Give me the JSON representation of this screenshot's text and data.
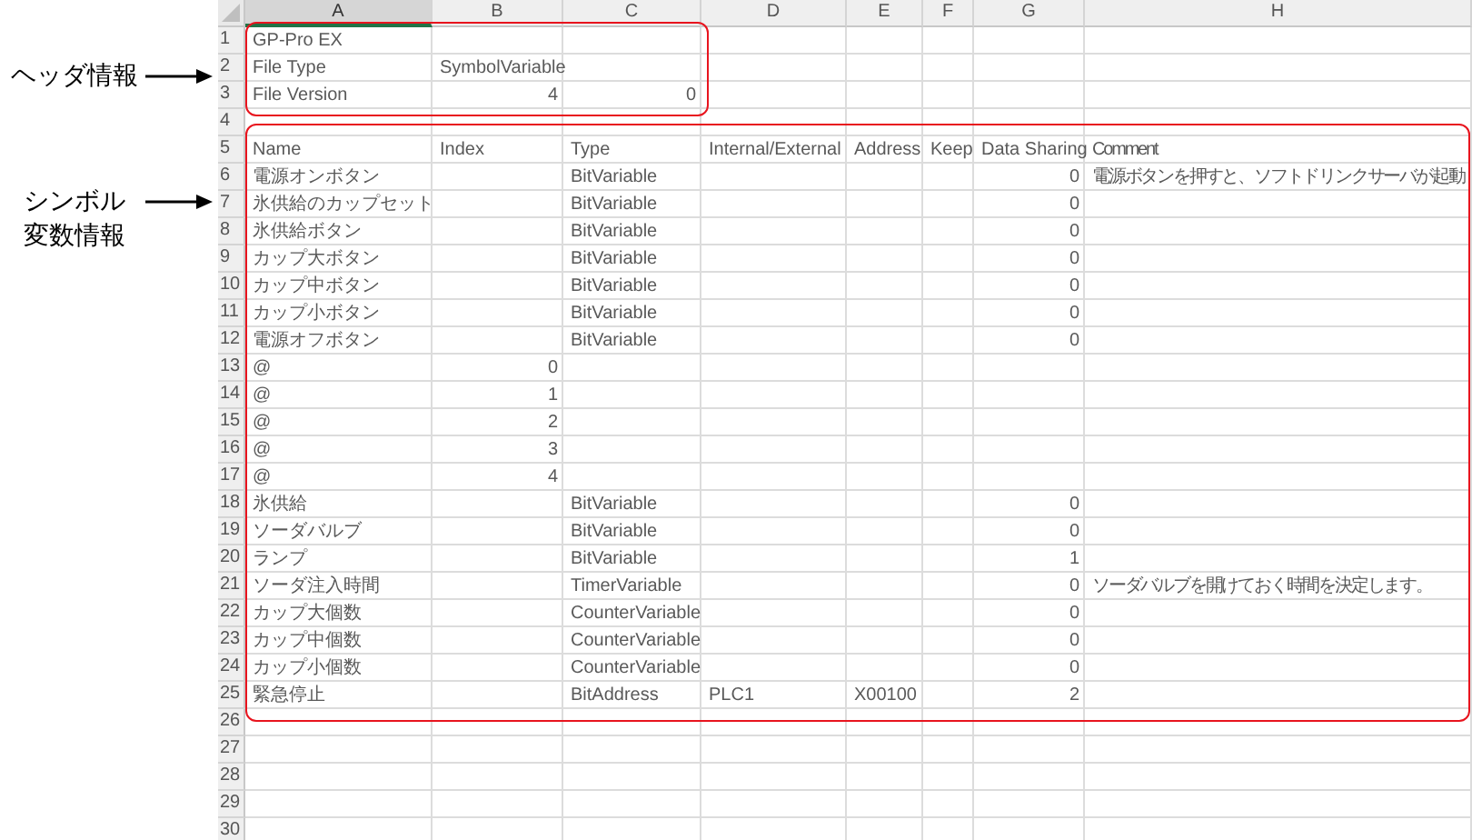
{
  "annotations": [
    {
      "lines": [
        "ヘッダ情報"
      ]
    },
    {
      "lines": [
        "シンボル",
        "変数情報"
      ]
    }
  ],
  "columns": [
    {
      "label": "A",
      "selected": true
    },
    {
      "label": "B",
      "selected": false
    },
    {
      "label": "C",
      "selected": false
    },
    {
      "label": "D",
      "selected": false
    },
    {
      "label": "E",
      "selected": false
    },
    {
      "label": "F",
      "selected": false
    },
    {
      "label": "G",
      "selected": false
    },
    {
      "label": "H",
      "selected": false
    }
  ],
  "rows": [
    {
      "number": "1",
      "cells": [
        {
          "text": "GP-Pro EX"
        }
      ]
    },
    {
      "number": "2",
      "cells": [
        {
          "text": "File Type"
        },
        {
          "text": "SymbolVariable"
        }
      ]
    },
    {
      "number": "3",
      "cells": [
        {
          "text": "File Version"
        },
        {
          "text": "4",
          "kind": "number"
        },
        {
          "text": "0",
          "kind": "number"
        }
      ]
    },
    {
      "number": "4",
      "cells": []
    },
    {
      "number": "5",
      "cells": [
        {
          "text": "Name"
        },
        {
          "text": "Index"
        },
        {
          "text": "Type"
        },
        {
          "text": "Internal/External"
        },
        {
          "text": "Address"
        },
        {
          "text": "Keep"
        },
        {
          "text": "Data Sharing"
        },
        {
          "text": "Comment"
        }
      ]
    },
    {
      "number": "6",
      "cells": [
        {
          "text": "電源オンボタン"
        },
        {},
        {
          "text": "BitVariable"
        },
        {},
        {},
        {},
        {
          "text": "0",
          "kind": "number"
        },
        {
          "text": "電源ボタンを押すと、ソフトドリンクサーバが起動"
        }
      ]
    },
    {
      "number": "7",
      "cells": [
        {
          "text": "氷供給のカップセット"
        },
        {},
        {
          "text": "BitVariable"
        },
        {},
        {},
        {},
        {
          "text": "0",
          "kind": "number"
        }
      ]
    },
    {
      "number": "8",
      "cells": [
        {
          "text": "氷供給ボタン"
        },
        {},
        {
          "text": "BitVariable"
        },
        {},
        {},
        {},
        {
          "text": "0",
          "kind": "number"
        }
      ]
    },
    {
      "number": "9",
      "cells": [
        {
          "text": "カップ大ボタン"
        },
        {},
        {
          "text": "BitVariable"
        },
        {},
        {},
        {},
        {
          "text": "0",
          "kind": "number"
        }
      ]
    },
    {
      "number": "10",
      "cells": [
        {
          "text": "カップ中ボタン"
        },
        {},
        {
          "text": "BitVariable"
        },
        {},
        {},
        {},
        {
          "text": "0",
          "kind": "number"
        }
      ]
    },
    {
      "number": "11",
      "cells": [
        {
          "text": "カップ小ボタン"
        },
        {},
        {
          "text": "BitVariable"
        },
        {},
        {},
        {},
        {
          "text": "0",
          "kind": "number"
        }
      ]
    },
    {
      "number": "12",
      "cells": [
        {
          "text": "電源オフボタン"
        },
        {},
        {
          "text": "BitVariable"
        },
        {},
        {},
        {},
        {
          "text": "0",
          "kind": "number"
        }
      ]
    },
    {
      "number": "13",
      "cells": [
        {
          "text": "@"
        },
        {
          "text": "0",
          "kind": "number"
        }
      ]
    },
    {
      "number": "14",
      "cells": [
        {
          "text": "@"
        },
        {
          "text": "1",
          "kind": "number"
        }
      ]
    },
    {
      "number": "15",
      "cells": [
        {
          "text": "@"
        },
        {
          "text": "2",
          "kind": "number"
        }
      ]
    },
    {
      "number": "16",
      "cells": [
        {
          "text": "@"
        },
        {
          "text": "3",
          "kind": "number"
        }
      ]
    },
    {
      "number": "17",
      "cells": [
        {
          "text": "@"
        },
        {
          "text": "4",
          "kind": "number"
        }
      ]
    },
    {
      "number": "18",
      "cells": [
        {
          "text": "氷供給"
        },
        {},
        {
          "text": "BitVariable"
        },
        {},
        {},
        {},
        {
          "text": "0",
          "kind": "number"
        }
      ]
    },
    {
      "number": "19",
      "cells": [
        {
          "text": "ソーダバルブ"
        },
        {},
        {
          "text": "BitVariable"
        },
        {},
        {},
        {},
        {
          "text": "0",
          "kind": "number"
        }
      ]
    },
    {
      "number": "20",
      "cells": [
        {
          "text": "ランプ"
        },
        {},
        {
          "text": "BitVariable"
        },
        {},
        {},
        {},
        {
          "text": "1",
          "kind": "number"
        }
      ]
    },
    {
      "number": "21",
      "cells": [
        {
          "text": "ソーダ注入時間"
        },
        {},
        {
          "text": "TimerVariable"
        },
        {},
        {},
        {},
        {
          "text": "0",
          "kind": "number"
        },
        {
          "text": "ソーダバルブを開けておく時間を決定します。"
        }
      ]
    },
    {
      "number": "22",
      "cells": [
        {
          "text": "カップ大個数"
        },
        {},
        {
          "text": "CounterVariable"
        },
        {},
        {},
        {},
        {
          "text": "0",
          "kind": "number"
        }
      ]
    },
    {
      "number": "23",
      "cells": [
        {
          "text": "カップ中個数"
        },
        {},
        {
          "text": "CounterVariable"
        },
        {},
        {},
        {},
        {
          "text": "0",
          "kind": "number"
        }
      ]
    },
    {
      "number": "24",
      "cells": [
        {
          "text": "カップ小個数"
        },
        {},
        {
          "text": "CounterVariable"
        },
        {},
        {},
        {},
        {
          "text": "0",
          "kind": "number"
        }
      ]
    },
    {
      "number": "25",
      "cells": [
        {
          "text": "緊急停止"
        },
        {},
        {
          "text": "BitAddress"
        },
        {
          "text": "PLC1"
        },
        {
          "text": "X00100"
        },
        {},
        {
          "text": "2",
          "kind": "number"
        }
      ]
    },
    {
      "number": "26",
      "cells": []
    },
    {
      "number": "27",
      "cells": []
    },
    {
      "number": "28",
      "cells": []
    },
    {
      "number": "29",
      "cells": []
    },
    {
      "number": "30",
      "cells": []
    }
  ]
}
